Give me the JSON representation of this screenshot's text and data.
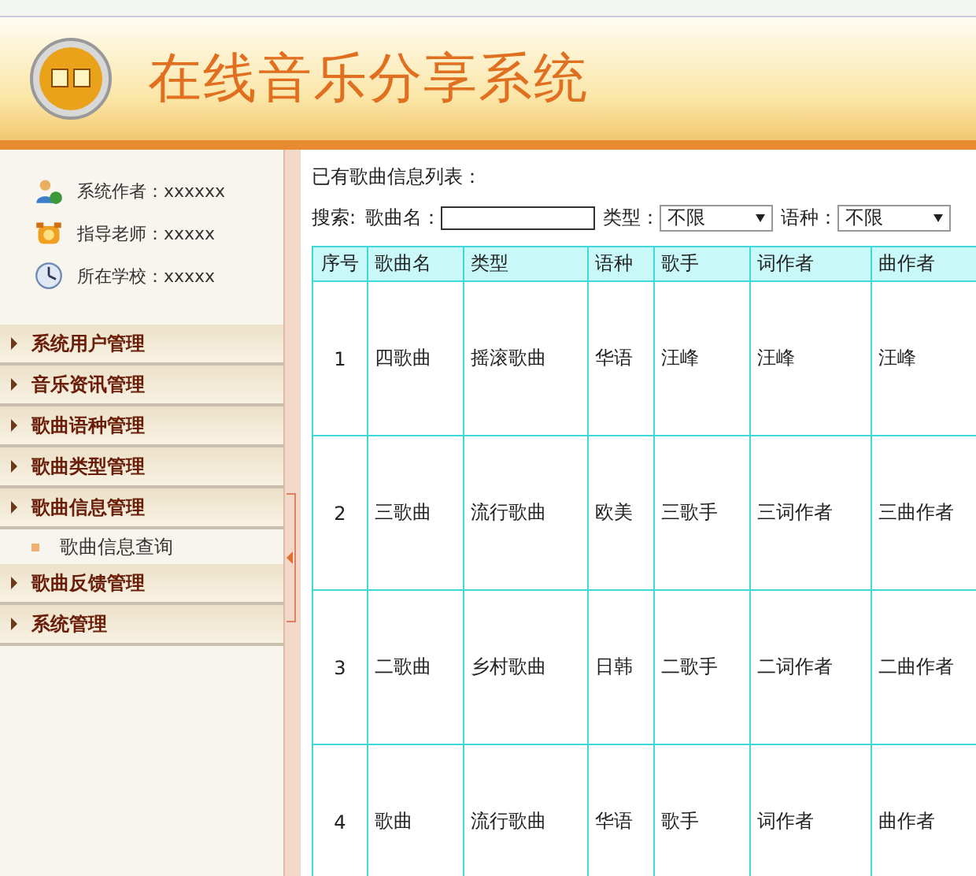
{
  "header": {
    "title": "在线音乐分享系统"
  },
  "sidebar": {
    "info": [
      {
        "kind": "author",
        "text": "系统作者：xxxxxx"
      },
      {
        "kind": "teacher",
        "text": "指导老师：xxxxx"
      },
      {
        "kind": "school",
        "text": "所在学校：xxxxx"
      }
    ],
    "menu": [
      {
        "label": "系统用户管理"
      },
      {
        "label": "音乐资讯管理"
      },
      {
        "label": "歌曲语种管理"
      },
      {
        "label": "歌曲类型管理"
      },
      {
        "label": "歌曲信息管理",
        "children": [
          {
            "label": "歌曲信息查询"
          }
        ]
      },
      {
        "label": "歌曲反馈管理"
      },
      {
        "label": "系统管理"
      }
    ]
  },
  "content": {
    "heading": "已有歌曲信息列表：",
    "search": {
      "label": "搜索:",
      "fields": [
        {
          "kind": "text",
          "label": "歌曲名："
        },
        {
          "kind": "select",
          "label": "类型：",
          "value": "不限"
        },
        {
          "kind": "select",
          "label": "语种：",
          "value": "不限"
        }
      ]
    },
    "table": {
      "columns": [
        "序号",
        "歌曲名",
        "类型",
        "语种",
        "歌手",
        "词作者",
        "曲作者"
      ],
      "rows": [
        [
          "1",
          "四歌曲",
          "摇滚歌曲",
          "华语",
          "汪峰",
          "汪峰",
          "汪峰"
        ],
        [
          "2",
          "三歌曲",
          "流行歌曲",
          "欧美",
          "三歌手",
          "三词作者",
          "三曲作者"
        ],
        [
          "3",
          "二歌曲",
          "乡村歌曲",
          "日韩",
          "二歌手",
          "二词作者",
          "二曲作者"
        ],
        [
          "4",
          "歌曲",
          "流行歌曲",
          "华语",
          "歌手",
          "词作者",
          "曲作者"
        ]
      ]
    }
  }
}
